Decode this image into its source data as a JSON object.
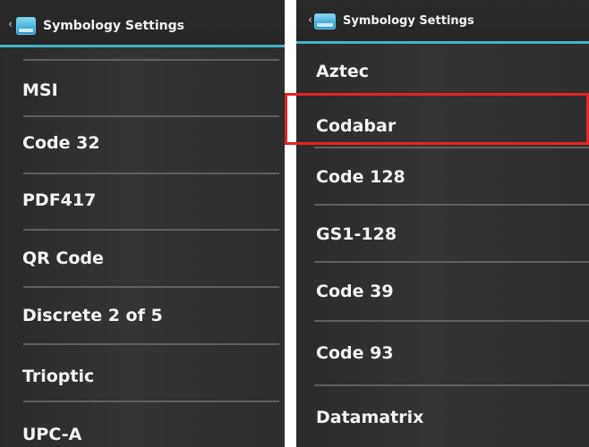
{
  "left_screen": {
    "title": "Symbology Settings",
    "back_glyph": "‹",
    "icon": "app-icon",
    "items": [
      {
        "label": "MSI"
      },
      {
        "label": "Code 32"
      },
      {
        "label": "PDF417"
      },
      {
        "label": "QR Code"
      },
      {
        "label": "Discrete 2 of 5"
      },
      {
        "label": "Trioptic"
      },
      {
        "label": "UPC-A"
      }
    ]
  },
  "right_screen": {
    "title": "Symbology Settings",
    "back_glyph": "‹",
    "icon": "app-icon",
    "items": [
      {
        "label": "Aztec"
      },
      {
        "label": "Codabar"
      },
      {
        "label": "Code 128"
      },
      {
        "label": "GS1-128"
      },
      {
        "label": "Code 39"
      },
      {
        "label": "Code 93"
      },
      {
        "label": "Datamatrix"
      }
    ],
    "highlighted_item": "Codabar"
  },
  "colors": {
    "accent": "#46b3c8",
    "highlight": "#e52323",
    "background": "#2e2e2e",
    "text": "#f4f4f4"
  }
}
